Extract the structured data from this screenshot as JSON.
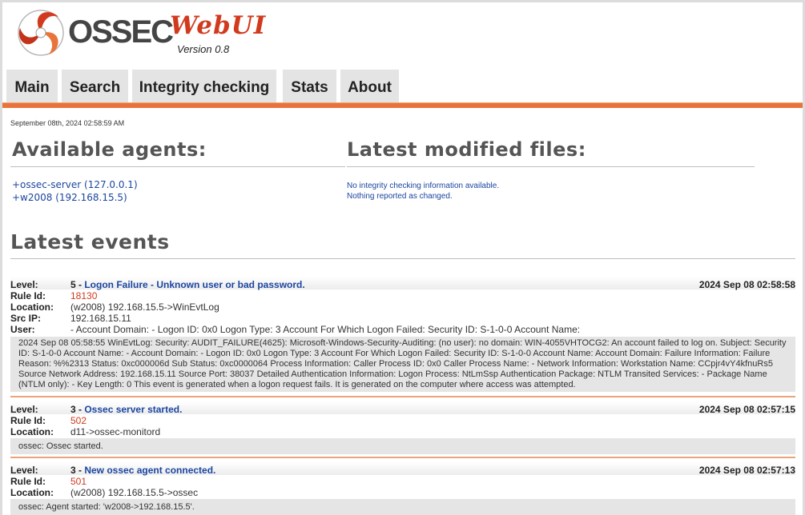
{
  "header": {
    "logo_main": "OSSEC",
    "logo_sub": "WebUI",
    "version": "Version 0.8",
    "tabs": [
      {
        "label": "Main"
      },
      {
        "label": "Search"
      },
      {
        "label": "Integrity checking"
      },
      {
        "label": "Stats"
      },
      {
        "label": "About"
      }
    ]
  },
  "date": "September 08th, 2024 02:58:59 AM",
  "agents": {
    "title": "Available agents:",
    "items": [
      {
        "label": "+ossec-server (127.0.0.1)"
      },
      {
        "label": "+w2008 (192.168.15.5)"
      }
    ]
  },
  "files": {
    "title": "Latest modified files:",
    "messages": [
      "No integrity checking information available.",
      "Nothing reported as changed."
    ]
  },
  "events_title": "Latest events",
  "labels": {
    "level": "Level:",
    "rule_id": "Rule Id:",
    "location": "Location:",
    "src_ip": "Src IP:",
    "user": "User:"
  },
  "events": [
    {
      "level": "5 - ",
      "description": "Logon Failure - Unknown user or bad password.",
      "date": "2024 Sep 08 02:58:58",
      "rule_id": "18130",
      "location": "(w2008) 192.168.15.5->WinEvtLog",
      "src_ip": "192.168.15.11",
      "user": "- Account Domain: - Logon ID: 0x0 Logon Type: 3 Account For Which Logon Failed: Security ID: S-1-0-0 Account Name:",
      "message": "2024 Sep 08 05:58:55 WinEvtLog: Security: AUDIT_FAILURE(4625): Microsoft-Windows-Security-Auditing: (no user): no domain: WIN-4055VHTOCG2: An account failed to log on. Subject: Security ID: S-1-0-0 Account Name: - Account Domain: - Logon ID: 0x0 Logon Type: 3 Account For Which Logon Failed: Security ID: S-1-0-0 Account Name: Account Domain: Failure Information: Failure Reason: %%2313 Status: 0xc000006d Sub Status: 0xc0000064 Process Information: Caller Process ID: 0x0 Caller Process Name: - Network Information: Workstation Name: CCpjr4vY4kfnuRs5 Source Network Address: 192.168.15.11 Source Port: 38037 Detailed Authentication Information: Logon Process: NtLmSsp Authentication Package: NTLM Transited Services: - Package Name (NTLM only): - Key Length: 0 This event is generated when a logon request fails. It is generated on the computer where access was attempted."
    },
    {
      "level": "3 - ",
      "description": "Ossec server started.",
      "date": "2024 Sep 08 02:57:15",
      "rule_id": "502",
      "location": "d11->ossec-monitord",
      "message": "ossec: Ossec started."
    },
    {
      "level": "3 - ",
      "description": "New ossec agent connected.",
      "date": "2024 Sep 08 02:57:13",
      "rule_id": "501",
      "location": "(w2008) 192.168.15.5->ossec",
      "message": "ossec: Agent started: 'w2008->192.168.15.5'."
    }
  ],
  "colors": {
    "accent": "#e8743b",
    "link": "#1c46a0",
    "rule_link": "#d23a1e",
    "tab_bg": "#e4e4e4"
  }
}
